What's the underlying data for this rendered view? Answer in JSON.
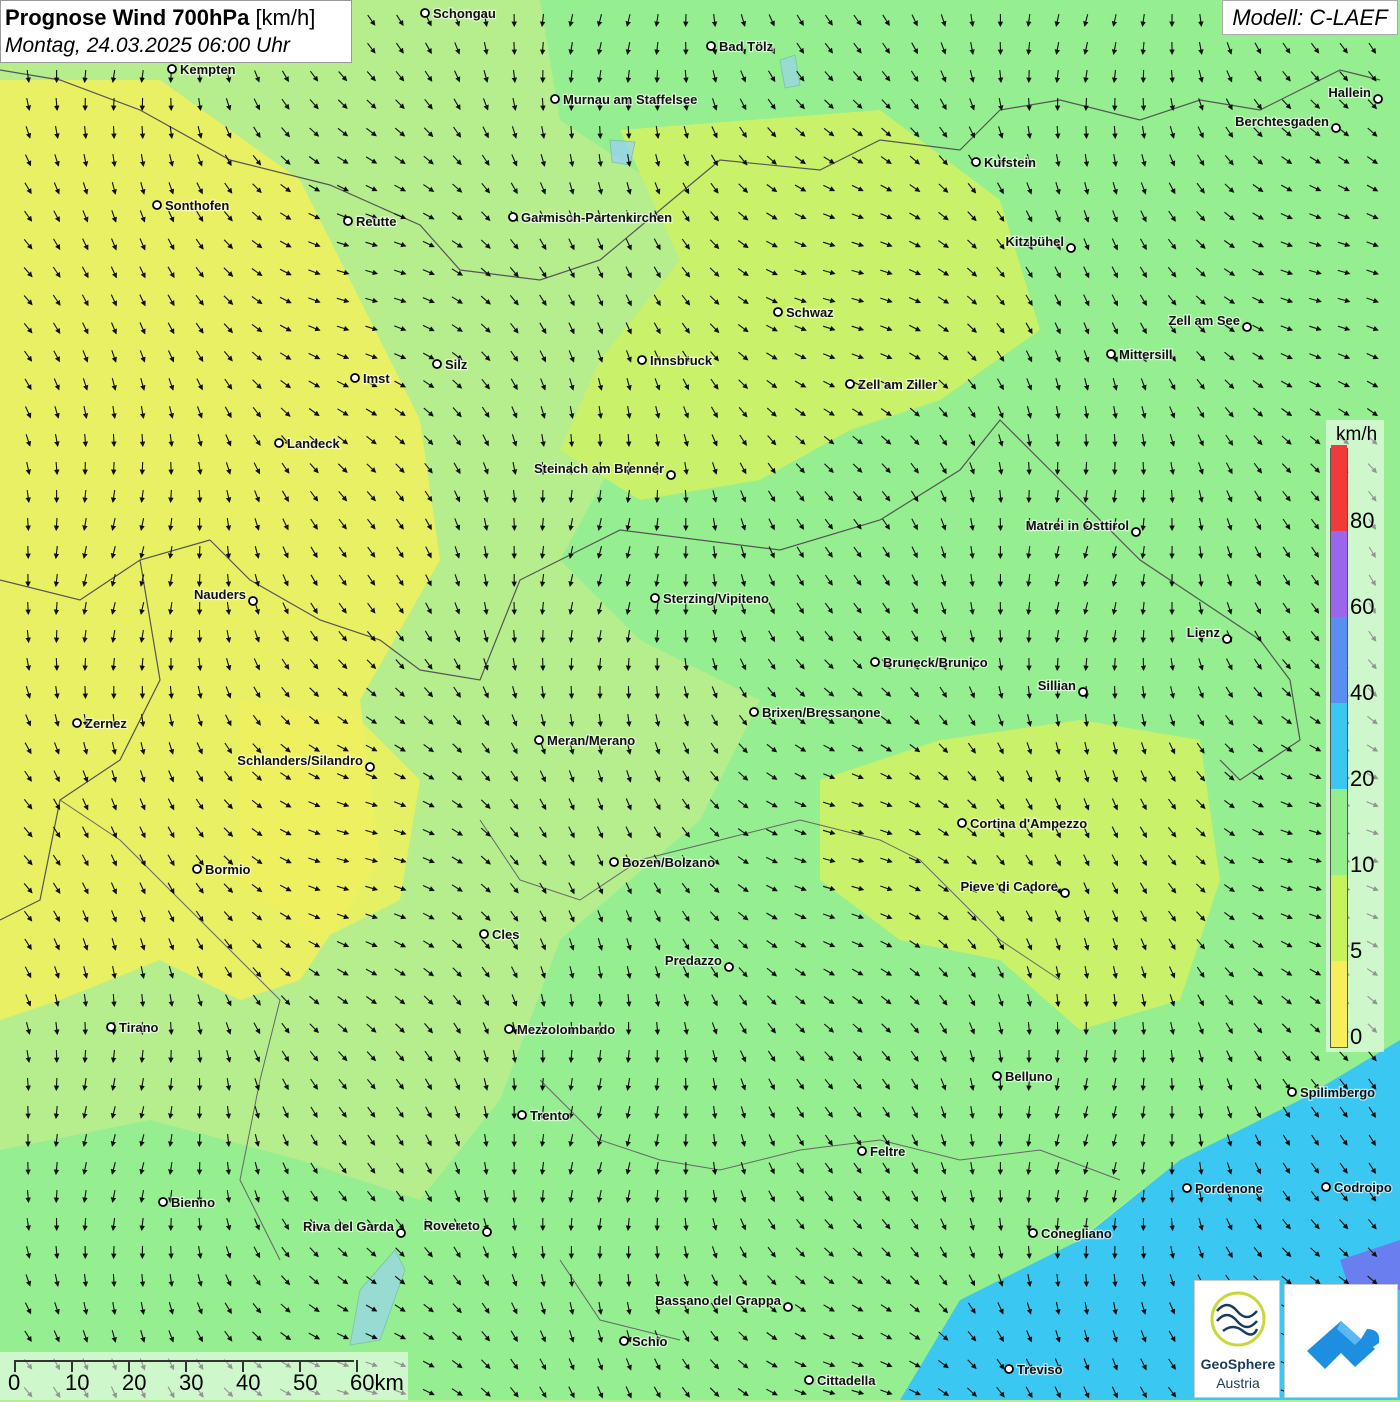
{
  "header": {
    "title_main": "Prognose Wind 700hPa",
    "title_unit": "[km/h]",
    "datetime": "Montag, 24.03.2025 06:00 Uhr",
    "model": "Modell: C-LAEF"
  },
  "legend": {
    "unit": "km/h",
    "labels": [
      "0",
      "5",
      "10",
      "20",
      "40",
      "60",
      "80"
    ],
    "colors": [
      "#f6ef5a",
      "#c8f25a",
      "#94ee8c",
      "#3ac8f2",
      "#5a8ef0",
      "#9a66ee",
      "#f23a3a"
    ]
  },
  "scalebar": {
    "labels": [
      "0",
      "10",
      "20",
      "30",
      "40",
      "50",
      "60km"
    ]
  },
  "logos": {
    "geosphere_title": "GeoSphere",
    "geosphere_sub": "Austria",
    "geosphere_icon": "geosphere-logo-icon",
    "app_icon": "wetter-app-cloud-icon"
  },
  "cities": [
    {
      "name": "Schongau",
      "label_side": "right"
    },
    {
      "name": "Bad Tölz",
      "label_side": "right"
    },
    {
      "name": "Kempten",
      "label_side": "right"
    },
    {
      "name": "Murnau am Staffelsee",
      "label_side": "right"
    },
    {
      "name": "Hallein",
      "label_side": "left"
    },
    {
      "name": "Berchtesgaden",
      "label_side": "left"
    },
    {
      "name": "Kufstein",
      "label_side": "right"
    },
    {
      "name": "Sonthofen",
      "label_side": "right"
    },
    {
      "name": "Reutte",
      "label_side": "right"
    },
    {
      "name": "Garmisch-Partenkirchen",
      "label_side": "right"
    },
    {
      "name": "Kitzbühel",
      "label_side": "left"
    },
    {
      "name": "Schwaz",
      "label_side": "right"
    },
    {
      "name": "Zell am See",
      "label_side": "left"
    },
    {
      "name": "Mittersill",
      "label_side": "right"
    },
    {
      "name": "Innsbruck",
      "label_side": "right"
    },
    {
      "name": "Silz",
      "label_side": "right"
    },
    {
      "name": "Imst",
      "label_side": "right"
    },
    {
      "name": "Zell am Ziller",
      "label_side": "right"
    },
    {
      "name": "Landeck",
      "label_side": "right"
    },
    {
      "name": "Steinach am Brenner",
      "label_side": "left"
    },
    {
      "name": "Matrei in Osttirol",
      "label_side": "left"
    },
    {
      "name": "Nauders",
      "label_side": "left"
    },
    {
      "name": "Sterzing/Vipiteno",
      "label_side": "right"
    },
    {
      "name": "Lienz",
      "label_side": "left"
    },
    {
      "name": "Bruneck/Brunico",
      "label_side": "right"
    },
    {
      "name": "Sillian",
      "label_side": "left"
    },
    {
      "name": "Zernez",
      "label_side": "right"
    },
    {
      "name": "Brixen/Bressanone",
      "label_side": "right"
    },
    {
      "name": "Meran/Merano",
      "label_side": "right"
    },
    {
      "name": "Schlanders/Silandro",
      "label_side": "left"
    },
    {
      "name": "Cortina d'Ampezzo",
      "label_side": "right"
    },
    {
      "name": "Bozen/Bolzano",
      "label_side": "right"
    },
    {
      "name": "Bormio",
      "label_side": "right"
    },
    {
      "name": "Pieve di Cadore",
      "label_side": "left"
    },
    {
      "name": "Cles",
      "label_side": "right"
    },
    {
      "name": "Predazzo",
      "label_side": "left"
    },
    {
      "name": "Tirano",
      "label_side": "right"
    },
    {
      "name": "Mezzolombardo",
      "label_side": "right"
    },
    {
      "name": "Belluno",
      "label_side": "right"
    },
    {
      "name": "Spilimbergo",
      "label_side": "right"
    },
    {
      "name": "Trento",
      "label_side": "right"
    },
    {
      "name": "Feltre",
      "label_side": "right"
    },
    {
      "name": "Bienno",
      "label_side": "right"
    },
    {
      "name": "Pordenone",
      "label_side": "right"
    },
    {
      "name": "Codroipo",
      "label_side": "right"
    },
    {
      "name": "Riva del Garda",
      "label_side": "left"
    },
    {
      "name": "Rovereto",
      "label_side": "left"
    },
    {
      "name": "Conegliano",
      "label_side": "right"
    },
    {
      "name": "Bassano del Grappa",
      "label_side": "left"
    },
    {
      "name": "Schio",
      "label_side": "right"
    },
    {
      "name": "Treviso",
      "label_side": "right"
    },
    {
      "name": "Cittadella",
      "label_side": "right"
    }
  ]
}
